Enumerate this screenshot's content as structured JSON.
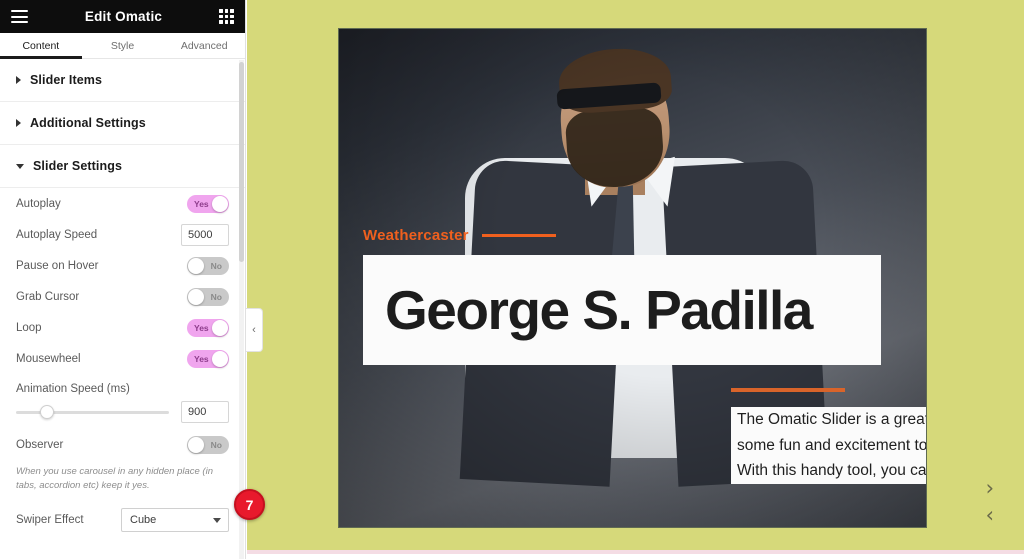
{
  "panel": {
    "title": "Edit Omatic",
    "menu_icon": "hamburger-icon",
    "grid_icon": "grid-apps-icon",
    "tabs": [
      {
        "label": "Content",
        "active": true
      },
      {
        "label": "Style",
        "active": false
      },
      {
        "label": "Advanced",
        "active": false
      }
    ],
    "sections": [
      {
        "label": "Slider Items",
        "expanded": false
      },
      {
        "label": "Additional Settings",
        "expanded": false
      },
      {
        "label": "Slider Settings",
        "expanded": true
      }
    ],
    "settings": {
      "autoplay": {
        "label": "Autoplay",
        "value": "Yes",
        "on": true
      },
      "autoplay_speed": {
        "label": "Autoplay Speed",
        "value": "5000"
      },
      "pause_on_hover": {
        "label": "Pause on Hover",
        "value": "No",
        "on": false
      },
      "grab_cursor": {
        "label": "Grab Cursor",
        "value": "No",
        "on": false
      },
      "loop": {
        "label": "Loop",
        "value": "Yes",
        "on": true
      },
      "mousewheel": {
        "label": "Mousewheel",
        "value": "Yes",
        "on": true
      },
      "animation_speed": {
        "label": "Animation Speed (ms)",
        "value": "900",
        "slider_percent": 20
      },
      "observer": {
        "label": "Observer",
        "value": "No",
        "on": false
      },
      "observer_note": "When you use carousel in any hidden place (in tabs, accordion etc) keep it yes.",
      "swiper_effect": {
        "label": "Swiper Effect",
        "value": "Cube"
      }
    },
    "step_badge": "7",
    "collapse_chevron": "‹"
  },
  "canvas": {
    "background_color": "#d6d97a",
    "slide": {
      "subtitle": "Weathercaster",
      "subtitle_color": "#f0601e",
      "title": "George S. Padilla",
      "description": [
        "The Omatic Slider is a great way to add",
        "some fun and excitement to your photos.",
        "With this handy tool, you can easily"
      ]
    },
    "nav": {
      "next": "›",
      "prev": "‹"
    }
  }
}
